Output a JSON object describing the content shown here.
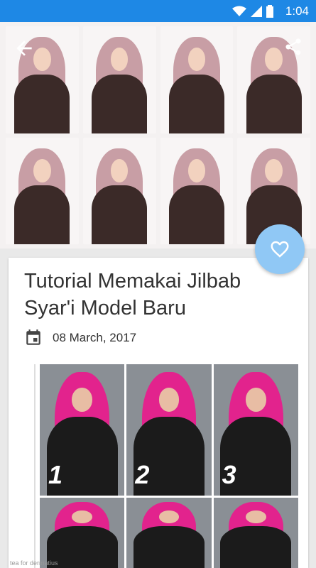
{
  "status_bar": {
    "time": "1:04"
  },
  "hero": {
    "image_desc_icon": "hijab-tutorial-image"
  },
  "article": {
    "title": "Tutorial Memakai Jilbab Syar'i Model Baru",
    "date": "08 March, 2017",
    "step_numbers": [
      "1",
      "2",
      "3"
    ]
  },
  "watermark": "tea for dermatius",
  "colors": {
    "status_bar": "#1e88e5",
    "fab": "#90c8f5"
  }
}
